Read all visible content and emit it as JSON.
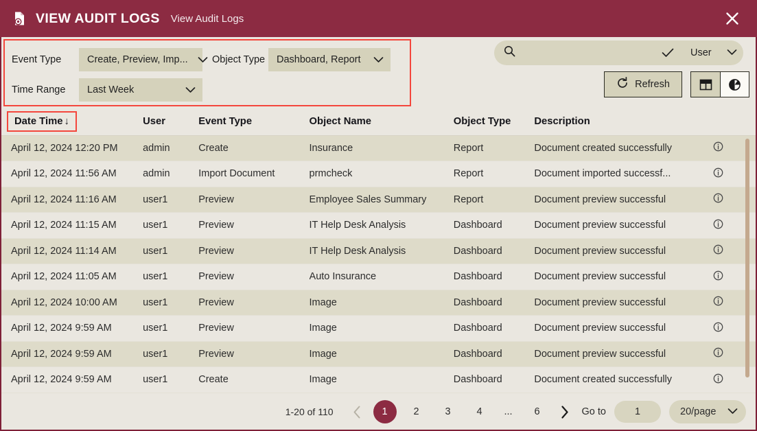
{
  "window": {
    "title": "VIEW AUDIT LOGS",
    "subtitle": "View Audit Logs",
    "doc_icon": "document-eye-icon",
    "close_icon": "close-icon",
    "header_color": "#8c2b42",
    "accent_color": "#8c2b42",
    "highlight_box_color": "#f4463c"
  },
  "filters": {
    "event_type": {
      "label": "Event Type",
      "value": "Create, Preview, Imp..."
    },
    "object_type": {
      "label": "Object Type",
      "value": "Dashboard, Report"
    },
    "time_range": {
      "label": "Time Range",
      "value": "Last Week"
    }
  },
  "search": {
    "placeholder": "",
    "value": "",
    "search_icon": "search-icon",
    "confirm_icon": "check-icon",
    "scope": "User"
  },
  "toolbar": {
    "refresh_label": "Refresh",
    "refresh_icon": "refresh-icon",
    "grid_view_icon": "table-grid-icon",
    "chart_view_icon": "pie-chart-icon"
  },
  "table": {
    "columns": [
      "Date Time",
      "User",
      "Event Type",
      "Object Name",
      "Object Type",
      "Description"
    ],
    "sort_column": "Date Time",
    "sort_indicator": "↓",
    "info_icon": "info-circle-icon",
    "rows": [
      {
        "datetime": "April 12, 2024 12:20 PM",
        "user": "admin",
        "event": "Create",
        "object_name": "Insurance",
        "object_type": "Report",
        "description": "Document created successfully"
      },
      {
        "datetime": "April 12, 2024 11:56 AM",
        "user": "admin",
        "event": "Import Document",
        "object_name": "prmcheck",
        "object_type": "Report",
        "description": "Document imported successf..."
      },
      {
        "datetime": "April 12, 2024 11:16 AM",
        "user": "user1",
        "event": "Preview",
        "object_name": "Employee Sales Summary",
        "object_type": "Report",
        "description": "Document preview successful"
      },
      {
        "datetime": "April 12, 2024 11:15 AM",
        "user": "user1",
        "event": "Preview",
        "object_name": "IT Help Desk Analysis",
        "object_type": "Dashboard",
        "description": "Document preview successful"
      },
      {
        "datetime": "April 12, 2024 11:14 AM",
        "user": "user1",
        "event": "Preview",
        "object_name": "IT Help Desk Analysis",
        "object_type": "Dashboard",
        "description": "Document preview successful"
      },
      {
        "datetime": "April 12, 2024 11:05 AM",
        "user": "user1",
        "event": "Preview",
        "object_name": "Auto Insurance",
        "object_type": "Dashboard",
        "description": "Document preview successful"
      },
      {
        "datetime": "April 12, 2024 10:00 AM",
        "user": "user1",
        "event": "Preview",
        "object_name": "Image",
        "object_type": "Dashboard",
        "description": "Document preview successful"
      },
      {
        "datetime": "April 12, 2024 9:59 AM",
        "user": "user1",
        "event": "Preview",
        "object_name": "Image",
        "object_type": "Dashboard",
        "description": "Document preview successful"
      },
      {
        "datetime": "April 12, 2024 9:59 AM",
        "user": "user1",
        "event": "Preview",
        "object_name": "Image",
        "object_type": "Dashboard",
        "description": "Document preview successful"
      },
      {
        "datetime": "April 12, 2024 9:59 AM",
        "user": "user1",
        "event": "Create",
        "object_name": "Image",
        "object_type": "Dashboard",
        "description": "Document created successfully"
      }
    ]
  },
  "pagination": {
    "range_text": "1-20 of 110",
    "prev_icon": "chevron-left-icon",
    "next_icon": "chevron-right-icon",
    "pages": [
      "1",
      "2",
      "3",
      "4",
      "...",
      "6"
    ],
    "current_page": "1",
    "goto_label": "Go to",
    "goto_value": "1",
    "per_page": "20/page"
  }
}
